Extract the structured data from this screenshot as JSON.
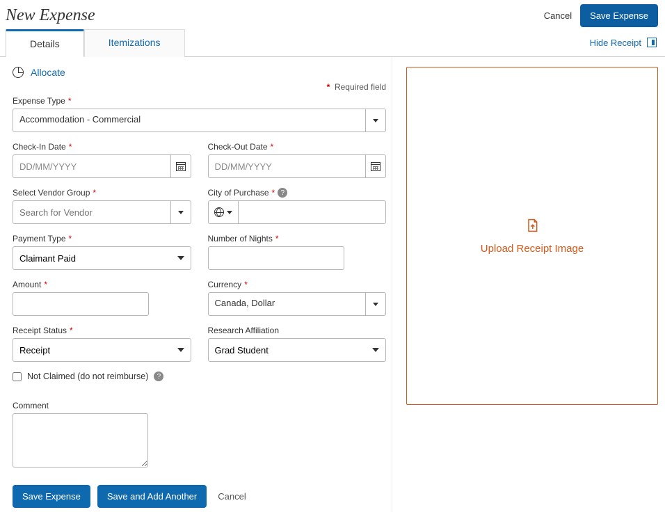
{
  "header": {
    "title": "New Expense",
    "cancel": "Cancel",
    "save": "Save Expense"
  },
  "tabs": {
    "details": "Details",
    "itemizations": "Itemizations",
    "hide_receipt": "Hide Receipt"
  },
  "actions": {
    "allocate": "Allocate",
    "required_note": "Required field"
  },
  "fields": {
    "expense_type": {
      "label": "Expense Type",
      "value": "Accommodation - Commercial"
    },
    "check_in": {
      "label": "Check-In Date",
      "placeholder": "DD/MM/YYYY",
      "value": ""
    },
    "check_out": {
      "label": "Check-Out Date",
      "placeholder": "DD/MM/YYYY",
      "value": ""
    },
    "vendor_group": {
      "label": "Select Vendor Group",
      "placeholder": "Search for Vendor",
      "value": ""
    },
    "city": {
      "label": "City of Purchase",
      "value": ""
    },
    "payment_type": {
      "label": "Payment Type",
      "value": "Claimant Paid"
    },
    "nights": {
      "label": "Number of Nights",
      "value": ""
    },
    "amount": {
      "label": "Amount",
      "value": ""
    },
    "currency": {
      "label": "Currency",
      "value": "Canada, Dollar"
    },
    "receipt_status": {
      "label": "Receipt Status",
      "value": "Receipt"
    },
    "research_affiliation": {
      "label": "Research Affiliation",
      "value": "Grad Student"
    },
    "not_claimed": {
      "label": "Not Claimed (do not reimburse)",
      "checked": false
    },
    "comment": {
      "label": "Comment",
      "value": ""
    }
  },
  "bottom": {
    "save": "Save Expense",
    "save_another": "Save and Add Another",
    "cancel": "Cancel"
  },
  "receipt": {
    "upload_label": "Upload Receipt Image"
  }
}
